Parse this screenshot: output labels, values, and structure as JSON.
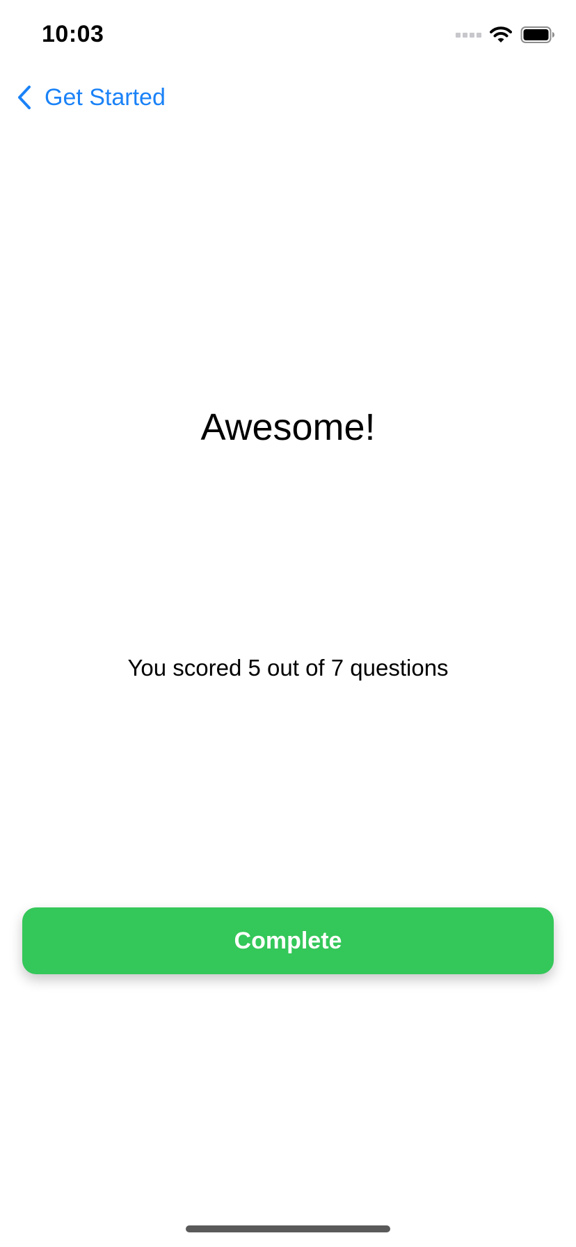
{
  "status_bar": {
    "time": "10:03",
    "icons": [
      "cellular-signal-icon",
      "wifi-icon",
      "battery-icon"
    ]
  },
  "nav": {
    "back_label": "Get Started",
    "back_icon": "chevron-left-icon"
  },
  "result": {
    "headline": "Awesome!",
    "score_text": "You scored 5 out of 7 questions",
    "score": 5,
    "total_questions": 7
  },
  "actions": {
    "complete_label": "Complete"
  },
  "colors": {
    "accent": "#1a82f7",
    "button": "#34c759",
    "button_text": "#ffffff",
    "background": "#ffffff"
  }
}
